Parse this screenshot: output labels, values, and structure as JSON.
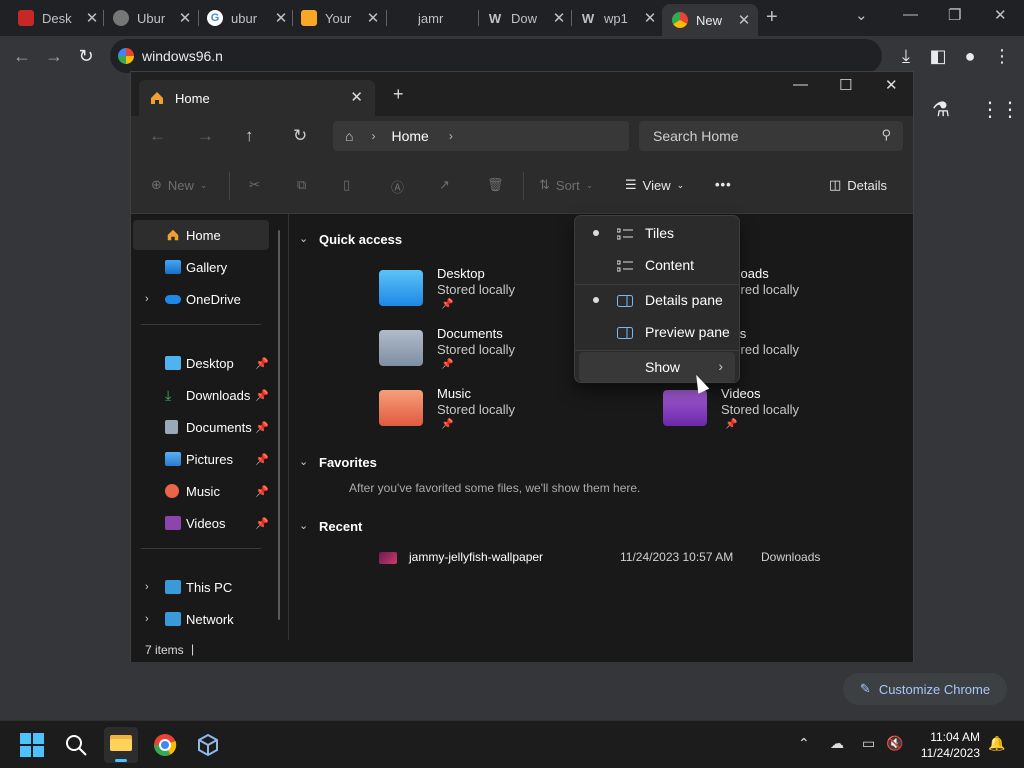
{
  "browser": {
    "tabs": [
      {
        "label": "Desk",
        "icon": "desktop-icon"
      },
      {
        "label": "Ubur",
        "icon": "ubuntu-icon"
      },
      {
        "label": "ubur",
        "icon": "google-icon"
      },
      {
        "label": "Your",
        "icon": "image-icon"
      },
      {
        "label": "jamr",
        "icon": "none"
      },
      {
        "label": "Dow",
        "icon": "w-icon"
      },
      {
        "label": "wp1",
        "icon": "w-icon"
      },
      {
        "label": "New",
        "icon": "chrome-icon"
      }
    ],
    "address": "windows96.n",
    "customize_label": "Customize Chrome"
  },
  "explorer": {
    "tab_title": "Home",
    "breadcrumb": "Home",
    "search_placeholder": "Search Home",
    "commands": {
      "new": "New",
      "sort": "Sort",
      "view": "View",
      "more": "•••",
      "details": "Details"
    },
    "nav": {
      "top": [
        {
          "label": "Home",
          "selected": true
        },
        {
          "label": "Gallery"
        },
        {
          "label": "OneDrive"
        }
      ],
      "pinned": [
        "Desktop",
        "Downloads",
        "Documents",
        "Pictures",
        "Music",
        "Videos"
      ],
      "bottom": [
        "This PC",
        "Network"
      ]
    },
    "sections": {
      "quick_access": "Quick access",
      "favorites": "Favorites",
      "favorites_note": "After you've favorited some files, we'll show them here.",
      "recent": "Recent"
    },
    "quick_access": [
      {
        "name": "Desktop",
        "sub": "Stored locally"
      },
      {
        "name": "Documents",
        "sub": "Stored locally"
      },
      {
        "name": "Music",
        "sub": "Stored locally"
      },
      {
        "name": "wnloads",
        "sub": "Stored locally"
      },
      {
        "name": "ures",
        "sub": "Stored locally"
      },
      {
        "name": "Videos",
        "sub": "Stored locally"
      }
    ],
    "recent": [
      {
        "name": "jammy-jellyfish-wallpaper",
        "date": "11/24/2023 10:57 AM",
        "location": "Downloads"
      }
    ],
    "status": "7 items"
  },
  "view_menu": {
    "items": [
      {
        "label": "Tiles",
        "checked": true
      },
      {
        "label": "Content",
        "checked": false
      },
      {
        "label": "Details pane",
        "checked": true
      },
      {
        "label": "Preview pane",
        "checked": false
      },
      {
        "label": "Show",
        "submenu": true
      }
    ]
  },
  "taskbar": {
    "time": "11:04 AM",
    "date": "11/24/2023"
  },
  "colors": {
    "accent": "#a8c7fa",
    "explorer_bg": "#191919",
    "chrome_bg": "#202124"
  }
}
